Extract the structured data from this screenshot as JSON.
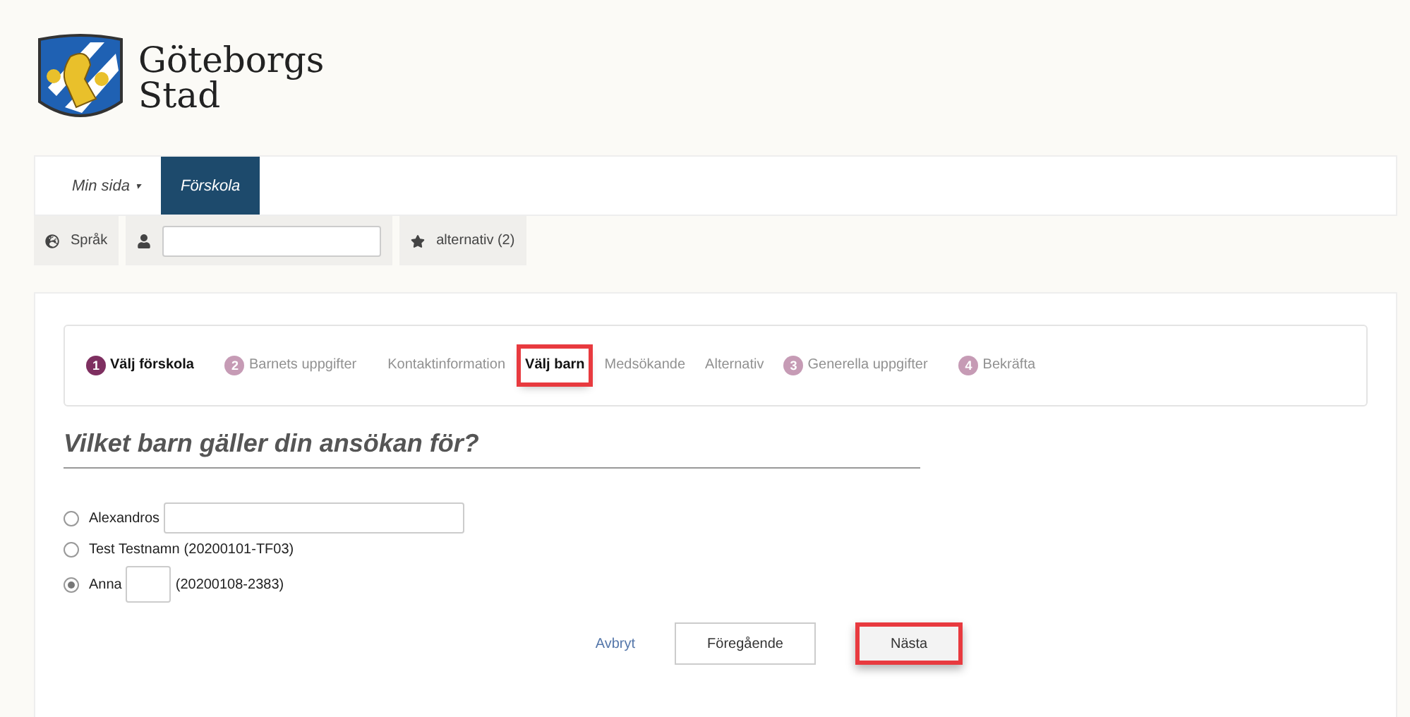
{
  "logo": {
    "line1": "Göteborgs",
    "line2": "Stad"
  },
  "nav": [
    {
      "label": "Min sida",
      "caret": "▾",
      "selected": false
    },
    {
      "label": "Förskola",
      "selected": true
    }
  ],
  "tools": {
    "language": "Språk",
    "alternatives": "alternativ (2)"
  },
  "steps": [
    {
      "number": "1",
      "label": "Välj förskola",
      "active": true,
      "highlighted": false
    },
    {
      "number": "2",
      "label": "Barnets uppgifter",
      "active": false,
      "highlighted": false
    },
    {
      "label": "Kontaktinformation",
      "active": false,
      "highlighted": false
    },
    {
      "label": "Välj barn",
      "active": true,
      "highlighted": true
    },
    {
      "label": "Medsökande",
      "active": false,
      "highlighted": false
    },
    {
      "label": "Alternativ",
      "active": false,
      "highlighted": false
    },
    {
      "number": "3",
      "label": "Generella uppgifter",
      "active": false,
      "highlighted": false
    },
    {
      "number": "4",
      "label": "Bekräfta",
      "active": false,
      "highlighted": false
    }
  ],
  "question": "Vilket barn gäller din ansökan för?",
  "children": [
    {
      "name": "Alexandros",
      "kind": "wide",
      "selected": false
    },
    {
      "name": "Test Testnamn",
      "kind": "plain",
      "id": "(20200101-TF03)",
      "selected": false
    },
    {
      "name": "Anna",
      "kind": "narrow",
      "id": "(20200108-2383)",
      "selected": true
    }
  ],
  "actions": {
    "cancel": "Avbryt",
    "previous": "Föregående",
    "next": "Nästa",
    "next_highlighted": true
  }
}
